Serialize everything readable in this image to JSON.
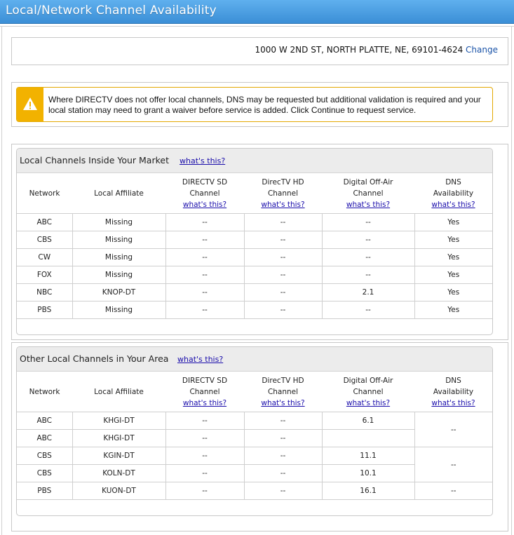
{
  "window": {
    "title": "Local/Network Channel Availability"
  },
  "address": {
    "text": "1000 W 2ND ST, NORTH PLATTE, NE, 69101-4624",
    "change_link": "Change"
  },
  "warning": {
    "icon": "warning-triangle-icon",
    "accent_color": "#f2b200",
    "message": "Where DIRECTV does not offer local channels, DNS may be requested but additional validation is required and your local station may need to grant a waiver before service is added. Click Continue to request service."
  },
  "columns": {
    "network": "Network",
    "affiliate": "Local Affiliate",
    "sd_line1": "DIRECTV SD",
    "sd_line2": "Channel",
    "hd_line1": "DirecTV HD",
    "hd_line2": "Channel",
    "air_line1": "Digital Off-Air",
    "air_line2": "Channel",
    "dns_line1": "DNS",
    "dns_line2": "Availability",
    "help_link": "what's this?"
  },
  "inside_market": {
    "title": "Local Channels Inside Your Market",
    "help_link": "what's this?",
    "rows": [
      {
        "network": "ABC",
        "affiliate": "Missing",
        "sd": "--",
        "hd": "--",
        "air": "--",
        "dns": "Yes"
      },
      {
        "network": "CBS",
        "affiliate": "Missing",
        "sd": "--",
        "hd": "--",
        "air": "--",
        "dns": "Yes"
      },
      {
        "network": "CW",
        "affiliate": "Missing",
        "sd": "--",
        "hd": "--",
        "air": "--",
        "dns": "Yes"
      },
      {
        "network": "FOX",
        "affiliate": "Missing",
        "sd": "--",
        "hd": "--",
        "air": "--",
        "dns": "Yes"
      },
      {
        "network": "NBC",
        "affiliate": "KNOP-DT",
        "sd": "--",
        "hd": "--",
        "air": "2.1",
        "dns": "Yes"
      },
      {
        "network": "PBS",
        "affiliate": "Missing",
        "sd": "--",
        "hd": "--",
        "air": "--",
        "dns": "Yes"
      }
    ]
  },
  "other_area": {
    "title": "Other Local Channels in Your Area",
    "help_link": "what's this?",
    "rows": [
      {
        "network": "ABC",
        "affiliate": "KHGI-DT",
        "sd": "--",
        "hd": "--",
        "air": "6.1"
      },
      {
        "network": "ABC",
        "affiliate": "KHGI-DT",
        "sd": "--",
        "hd": "--",
        "air": ""
      },
      {
        "network": "CBS",
        "affiliate": "KGIN-DT",
        "sd": "--",
        "hd": "--",
        "air": "11.1"
      },
      {
        "network": "CBS",
        "affiliate": "KOLN-DT",
        "sd": "--",
        "hd": "--",
        "air": "10.1"
      },
      {
        "network": "PBS",
        "affiliate": "KUON-DT",
        "sd": "--",
        "hd": "--",
        "air": "16.1"
      }
    ],
    "dns_groups": [
      "--",
      "--",
      "--"
    ]
  }
}
